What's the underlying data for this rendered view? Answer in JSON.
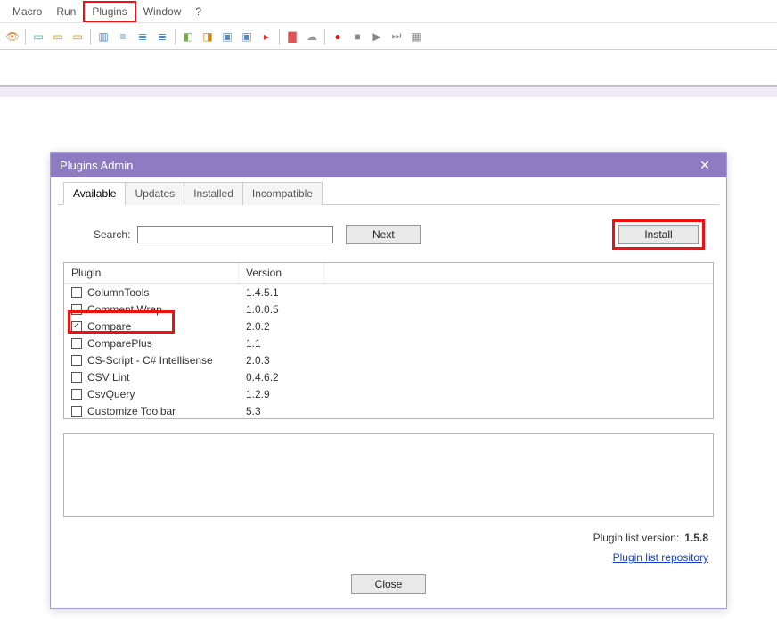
{
  "menu": {
    "items": [
      "Macro",
      "Run",
      "Plugins",
      "Window",
      "?"
    ],
    "highlighted_index": 2
  },
  "toolbar": {
    "icons": [
      {
        "name": "eye-icon",
        "glyph": "👁",
        "color": "#c84"
      },
      {
        "name": "doc1-icon",
        "glyph": "▭",
        "color": "#4a8"
      },
      {
        "name": "doc2-icon",
        "glyph": "▭",
        "color": "#c90"
      },
      {
        "name": "docx-icon",
        "glyph": "▭",
        "color": "#c90"
      },
      {
        "name": "gutter-icon",
        "glyph": "▥",
        "color": "#58b"
      },
      {
        "name": "indent-icon",
        "glyph": "≡",
        "color": "#58b"
      },
      {
        "name": "outdent1-icon",
        "glyph": "≣",
        "color": "#58b"
      },
      {
        "name": "outdent2-icon",
        "glyph": "≣",
        "color": "#58b"
      },
      {
        "name": "tool1-icon",
        "glyph": "◧",
        "color": "#7a5"
      },
      {
        "name": "tool2-icon",
        "glyph": "◨",
        "color": "#c80"
      },
      {
        "name": "tool3-icon",
        "glyph": "▣",
        "color": "#58b"
      },
      {
        "name": "tool4-icon",
        "glyph": "▣",
        "color": "#58b"
      },
      {
        "name": "flag-icon",
        "glyph": "▸",
        "color": "#d33"
      },
      {
        "name": "folder-icon",
        "glyph": "▇",
        "color": "#d55"
      },
      {
        "name": "cloud-icon",
        "glyph": "☁",
        "color": "#999"
      },
      {
        "name": "rec-icon",
        "glyph": "●",
        "color": "#d22"
      },
      {
        "name": "stop-icon",
        "glyph": "■",
        "color": "#888"
      },
      {
        "name": "play-icon",
        "glyph": "▶",
        "color": "#888"
      },
      {
        "name": "fwd-icon",
        "glyph": "⏭",
        "color": "#888"
      },
      {
        "name": "save-rec-icon",
        "glyph": "▦",
        "color": "#888"
      }
    ]
  },
  "dialog": {
    "title": "Plugins Admin",
    "tabs": [
      "Available",
      "Updates",
      "Installed",
      "Incompatible"
    ],
    "active_tab_index": 0,
    "search_label": "Search:",
    "search_value": "",
    "next_label": "Next",
    "install_label": "Install",
    "columns": {
      "plugin": "Plugin",
      "version": "Version"
    },
    "rows": [
      {
        "name": "ColumnTools",
        "version": "1.4.5.1",
        "checked": false
      },
      {
        "name": "Comment Wrap",
        "version": "1.0.0.5",
        "checked": false
      },
      {
        "name": "Compare",
        "version": "2.0.2",
        "checked": true
      },
      {
        "name": "ComparePlus",
        "version": "1.1",
        "checked": false
      },
      {
        "name": "CS-Script - C# Intellisense",
        "version": "2.0.3",
        "checked": false
      },
      {
        "name": "CSV Lint",
        "version": "0.4.6.2",
        "checked": false
      },
      {
        "name": "CsvQuery",
        "version": "1.2.9",
        "checked": false
      },
      {
        "name": "Customize Toolbar",
        "version": "5.3",
        "checked": false
      }
    ],
    "highlighted_row_index": 2,
    "footer": {
      "label": "Plugin list version:",
      "value": "1.5.8"
    },
    "repo_link": "Plugin list repository",
    "close_label": "Close",
    "checkmark": "✓"
  }
}
